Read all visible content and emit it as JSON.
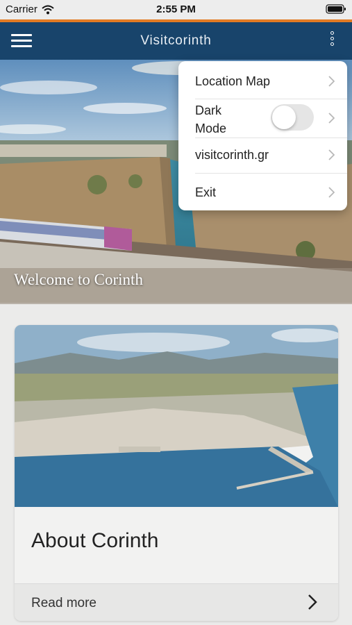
{
  "status_bar": {
    "carrier": "Carrier",
    "time": "2:55 PM",
    "wifi_icon": "wifi-icon",
    "battery_icon": "battery-icon"
  },
  "nav": {
    "title": "Visitcorinth",
    "menu_icon": "hamburger-menu-icon",
    "more_icon": "vertical-dots-icon",
    "bar_color": "#18446b",
    "accent_color": "#e27b24"
  },
  "hero": {
    "caption": "Welcome to Corinth",
    "image": "corinth-canal-train-bridge-photo"
  },
  "card": {
    "image": "corinth-aerial-city-photo",
    "title": "About Corinth",
    "read_more": "Read more"
  },
  "dropdown": {
    "items": [
      {
        "label": "Location Map"
      },
      {
        "label": "Dark Mode",
        "toggle_on": false
      },
      {
        "label": "visitcorinth.gr"
      },
      {
        "label": "Exit"
      }
    ]
  }
}
